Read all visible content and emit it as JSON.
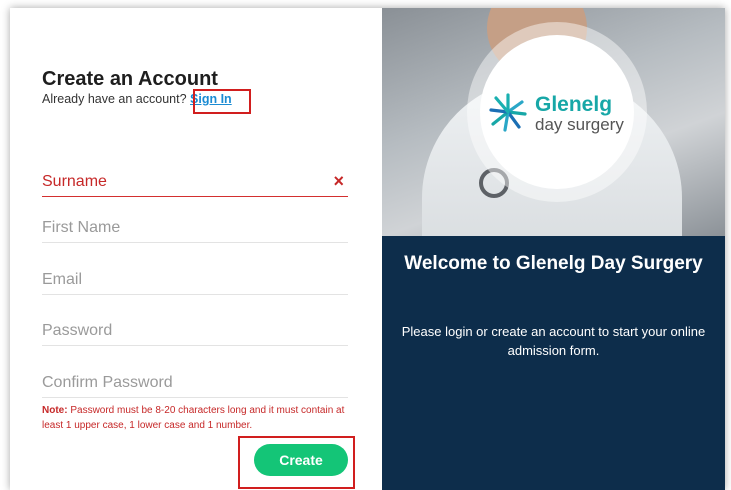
{
  "form": {
    "title": "Create an Account",
    "subtitle_prefix": "Already have an account? ",
    "signin_link": "Sign In",
    "fields": {
      "surname": {
        "placeholder": "Surname",
        "error": true
      },
      "first_name": {
        "placeholder": "First Name"
      },
      "email": {
        "placeholder": "Email"
      },
      "password": {
        "placeholder": "Password"
      },
      "confirm_password": {
        "placeholder": "Confirm Password"
      }
    },
    "error_icon": "×",
    "note_label": "Note:",
    "note_text": " Password must be 8-20 characters long and it must contain at least 1 upper case, 1 lower case and 1 number.",
    "create_button": "Create"
  },
  "panel": {
    "logo_line1": "Glenelg",
    "logo_line2": "day surgery",
    "welcome": "Welcome to Glenelg Day Surgery",
    "description": "Please login or create an account to start your online admission form."
  },
  "colors": {
    "accent_green": "#14c577",
    "panel_navy": "#0d2d4b",
    "error_red": "#c62828",
    "link_blue": "#1a8bd3",
    "highlight_red": "#d11e1e"
  }
}
